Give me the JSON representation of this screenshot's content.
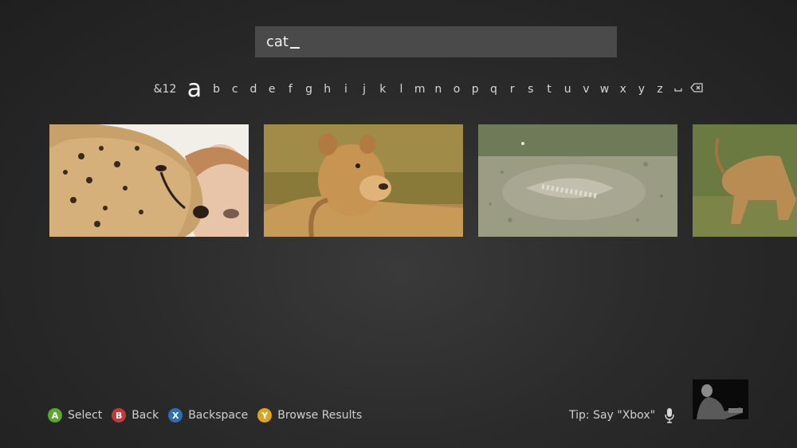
{
  "search": {
    "query": "cat"
  },
  "keyboard": {
    "symbols_label": "&12",
    "selected_letter": "a",
    "letters": [
      "b",
      "c",
      "d",
      "e",
      "f",
      "g",
      "h",
      "i",
      "j",
      "k",
      "l",
      "m",
      "n",
      "o",
      "p",
      "q",
      "r",
      "s",
      "t",
      "u",
      "v",
      "w",
      "x",
      "y",
      "z"
    ],
    "space_icon": "space-icon",
    "backspace_icon": "backspace-icon"
  },
  "results": [
    {
      "subject": "cheetah-and-woman",
      "icon": "video-thumbnail"
    },
    {
      "subject": "lioness",
      "icon": "video-thumbnail"
    },
    {
      "subject": "camouflaged-fish-on-sand",
      "icon": "video-thumbnail"
    },
    {
      "subject": "lion-walking",
      "icon": "video-thumbnail"
    }
  ],
  "footer": {
    "hints": [
      {
        "glyph": "A",
        "label": "Select",
        "color": "#5aa832"
      },
      {
        "glyph": "B",
        "label": "Back",
        "color": "#c03a3a"
      },
      {
        "glyph": "X",
        "label": "Backspace",
        "color": "#2e6fb0"
      },
      {
        "glyph": "Y",
        "label": "Browse Results",
        "color": "#d9a423"
      }
    ],
    "tip": "Tip: Say \"Xbox\"",
    "mic_icon": "microphone-icon"
  },
  "camera_feed": {
    "icon": "kinect-camera-feed"
  }
}
